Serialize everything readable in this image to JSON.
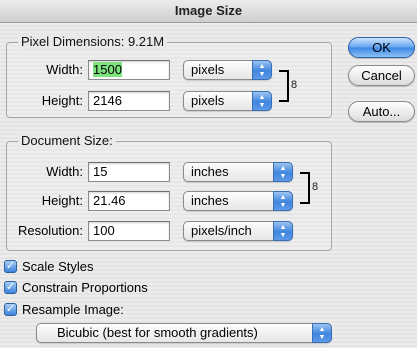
{
  "window": {
    "title": "Image Size"
  },
  "pixel_dimensions": {
    "legend": "Pixel Dimensions:",
    "size": "9.21M",
    "width_label": "Width:",
    "width_value": "1500",
    "width_unit": "pixels",
    "height_label": "Height:",
    "height_value": "2146",
    "height_unit": "pixels"
  },
  "document_size": {
    "legend": "Document Size:",
    "width_label": "Width:",
    "width_value": "15",
    "width_unit": "inches",
    "height_label": "Height:",
    "height_value": "21.46",
    "height_unit": "inches",
    "resolution_label": "Resolution:",
    "resolution_value": "100",
    "resolution_unit": "pixels/inch"
  },
  "options": {
    "scale_styles": {
      "label": "Scale Styles",
      "checked": true
    },
    "constrain_proportions": {
      "label": "Constrain Proportions",
      "checked": true
    },
    "resample_image": {
      "label": "Resample Image:",
      "checked": true
    },
    "resample_method": "Bicubic (best for smooth gradients)"
  },
  "buttons": {
    "ok": "OK",
    "cancel": "Cancel",
    "auto": "Auto..."
  },
  "icons": {
    "link": "chain-link-icon",
    "popup_arrows": "updown-arrows-icon",
    "checkmark": "check-icon"
  },
  "colors": {
    "accent": "#3a88e6",
    "selection": "#7ee27e"
  }
}
